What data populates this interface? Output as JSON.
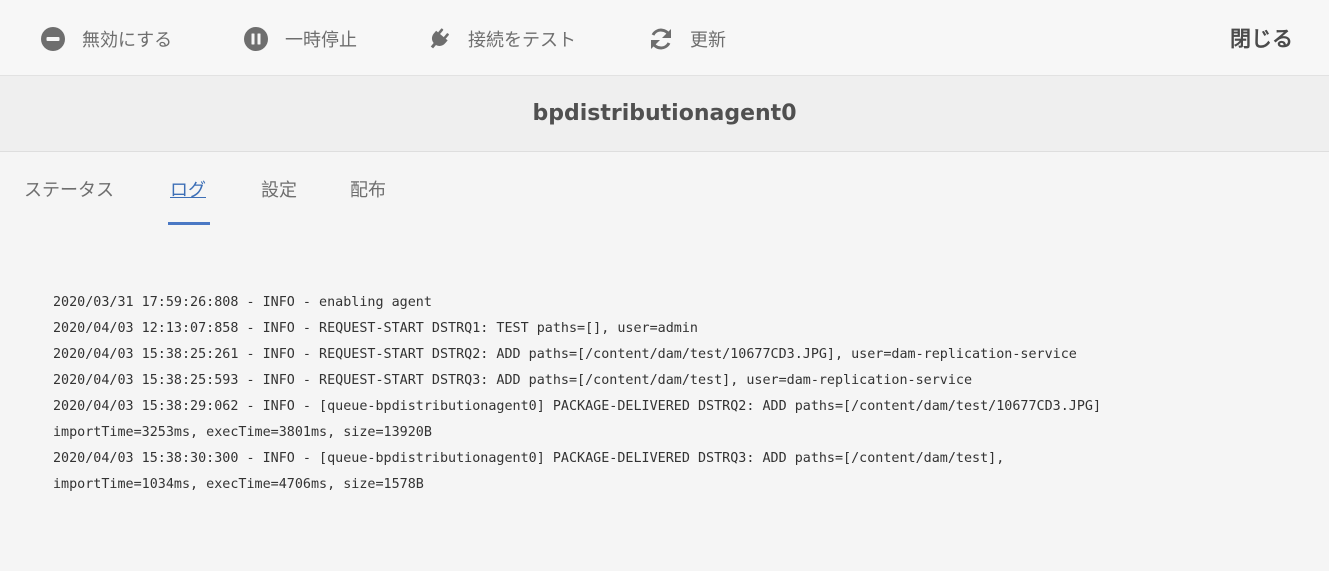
{
  "toolbar": {
    "disable_label": "無効にする",
    "pause_label": "一時停止",
    "test_label": "接続をテスト",
    "refresh_label": "更新",
    "close_label": "閉じる"
  },
  "header": {
    "title": "bpdistributionagent0"
  },
  "tabs": [
    {
      "label": "ステータス",
      "active": false
    },
    {
      "label": "ログ",
      "active": true
    },
    {
      "label": "設定",
      "active": false
    },
    {
      "label": "配布",
      "active": false
    }
  ],
  "log": {
    "lines": [
      "2020/03/31 17:59:26:808 - INFO - enabling agent",
      "2020/04/03 12:13:07:858 - INFO - REQUEST-START DSTRQ1: TEST paths=[], user=admin",
      "2020/04/03 15:38:25:261 - INFO - REQUEST-START DSTRQ2: ADD paths=[/content/dam/test/10677CD3.JPG], user=dam-replication-service",
      "2020/04/03 15:38:25:593 - INFO - REQUEST-START DSTRQ3: ADD paths=[/content/dam/test], user=dam-replication-service",
      "2020/04/03 15:38:29:062 - INFO - [queue-bpdistributionagent0] PACKAGE-DELIVERED DSTRQ2: ADD paths=[/content/dam/test/10677CD3.JPG]",
      "importTime=3253ms, execTime=3801ms, size=13920B",
      "2020/04/03 15:38:30:300 - INFO - [queue-bpdistributionagent0] PACKAGE-DELIVERED DSTRQ3: ADD paths=[/content/dam/test],",
      "importTime=1034ms, execTime=4706ms, size=1578B"
    ]
  },
  "colors": {
    "accent": "#4a78c4",
    "icon": "#6e6e6e"
  }
}
